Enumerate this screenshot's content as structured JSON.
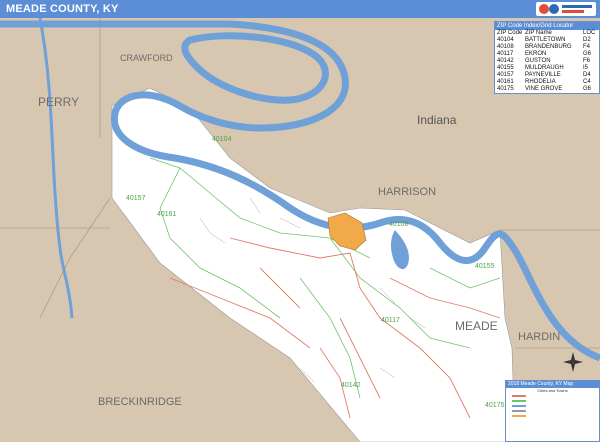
{
  "title": "MEADE COUNTY, KY",
  "labels": {
    "perry": "PERRY",
    "crawford": "CRAWFORD",
    "indiana": "Indiana",
    "harrison": "HARRISON",
    "meade": "MEADE",
    "hardin": "HARDIN",
    "breckinridge": "BRECKINRIDGE"
  },
  "zip_labels": [
    "40104",
    "40157",
    "40161",
    "40108",
    "40155",
    "40117",
    "40142",
    "40175"
  ],
  "zip_table": {
    "header": "ZIP Code Index/Grid Locator",
    "columns": [
      "ZIP Code",
      "ZIP Name",
      "LOC"
    ],
    "rows": [
      [
        "40104",
        "BATTLETOWN",
        "D2"
      ],
      [
        "40108",
        "BRANDENBURG",
        "F4"
      ],
      [
        "40117",
        "EKRON",
        "G6"
      ],
      [
        "40142",
        "GUSTON",
        "F6"
      ],
      [
        "40155",
        "MULDRAUGH",
        "I5"
      ],
      [
        "40157",
        "PAYNEVILLE",
        "D4"
      ],
      [
        "40161",
        "RHODELIA",
        "C4"
      ],
      [
        "40175",
        "VINE GROVE",
        "G6"
      ]
    ]
  },
  "legend": {
    "header": "2018 Meade County, KY Map",
    "subheader": "Cities and Towns"
  },
  "colors": {
    "title_bar": "#5b8ed6",
    "land_outside": "#d8c7b0",
    "county": "#ffffff",
    "river": "#6fa0d8",
    "zip_boundary": "#6ec46e",
    "roads": "#e07b6a",
    "highlight": "#f2a94a"
  }
}
